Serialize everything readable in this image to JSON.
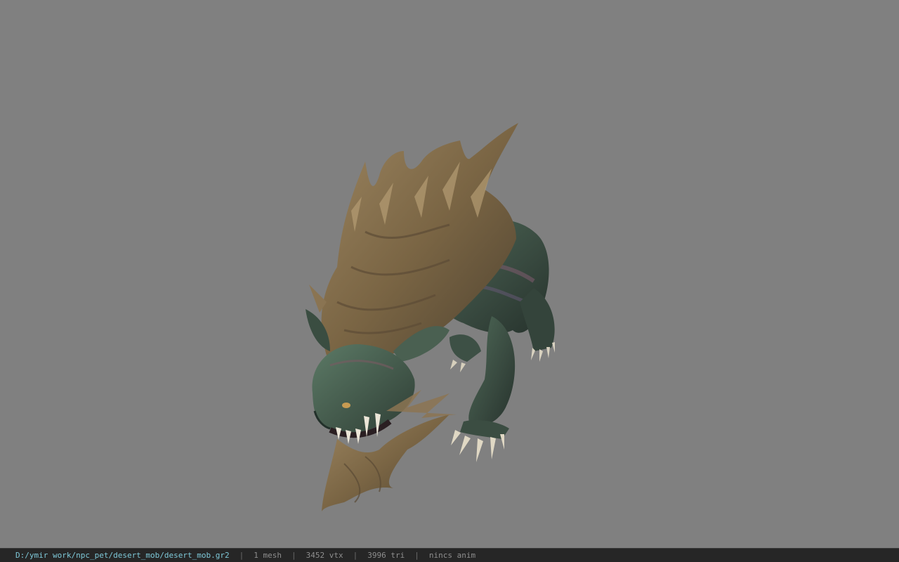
{
  "viewport": {
    "background_color": "#808080",
    "model_name": "desert_mob"
  },
  "statusbar": {
    "file_path": "D:/ymir work/npc_pet/desert_mob/desert_mob.gr2",
    "separator": "|",
    "mesh_count": "1 mesh",
    "vertex_count": "3452 vtx",
    "triangle_count": "3996 tri",
    "anim_status": "nincs anim",
    "path_color": "#7ec8d8",
    "text_color": "#8e8e8e"
  }
}
